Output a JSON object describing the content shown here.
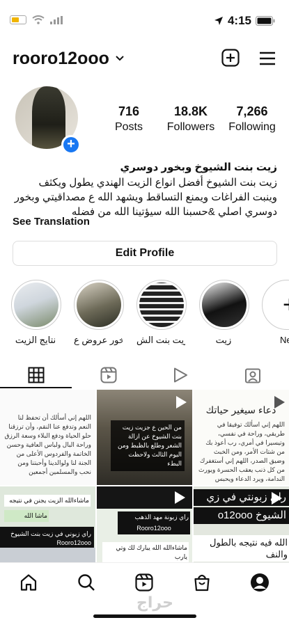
{
  "status": {
    "time": "4:15"
  },
  "header": {
    "username": "rooro12ooo"
  },
  "stats": [
    {
      "value": "716",
      "label": "Posts"
    },
    {
      "value": "18.8K",
      "label": "Followers"
    },
    {
      "value": "7,266",
      "label": "Following"
    }
  ],
  "bio": {
    "name": "زيت  بنت الشيوخ وبخور دوسري",
    "text": "زيت بنت الشيوخ أفضل انواع الزيت الهندي يطول ويكثف وينبت الفراغات ويمنع التساقط ويشهد الله ع مصداقيتي وبخور دوسري اصلي &حسبنا الله سيؤتينا الله من فضله",
    "see_translation": "See Translation"
  },
  "edit_profile": "Edit Profile",
  "highlights": [
    {
      "label": "نتايج الزيت"
    },
    {
      "label": "بخور عروض ع..."
    },
    {
      "label": "زيت بنت الش..."
    },
    {
      "label": "زيت"
    },
    {
      "label": "Ne"
    }
  ],
  "grid": {
    "p1": "اللهم إني أسألك أن تحفظ لنا النعم وتدفع عنا النقم، وأن ترزقنا حلو الحياة ودفع البلاء وسعة الرزق وراحة البال ولباس العافية وحسن الخاتمة والفردوس الأعلى من الجنة لنا ولوالدينا وأحبتنا ومن نحب والمسلمين أجمعين",
    "p2": "من الحين ع جزيت زيت بنت الشيوخ عن ازالة الشعر وطلع بالظبط ومن اليوم الثالث ولاحظت البطء",
    "p3_title": "دعاء سيغير حياتك",
    "p3_text": "اللهم إني اسألك توفيقا في طريقي، وراحة في نفسي، وتيسيرا في أمري، رب أعوذ بك من شتات الأمر، ومن الخبث وضيق الصدر، اللهم إني أستغفرك من كل ذنب يعقب الحسرة ويورث الندامة، ويرد الدعاء ويحبس الرزق، رب إن كان هناك ذنب يحول بيني وبين تيسير أموري فاغفره لي",
    "p4_a": "ماشاءالله الزيت يجنن في نتيجه",
    "p4_b": "ماشا الله",
    "p4_c": "راي زبوني في زيت بنت الشيوخ Rooro12ooo",
    "p5_a": "راي زبونة مهد الذهب",
    "p5_b": "Rooro12ooo",
    "p5_c": "ماشاءالله الله يبارك لك وتي يارب",
    "p6_a": "راي زبونتي في زي",
    "p6_b": "الشيوخ o12ooo",
    "p6_c": "الله فيه نتيجه بالطول والنف"
  },
  "watermark": "حراج",
  "colors": {
    "accent": "#1877f2",
    "battery": "#f0b400"
  }
}
